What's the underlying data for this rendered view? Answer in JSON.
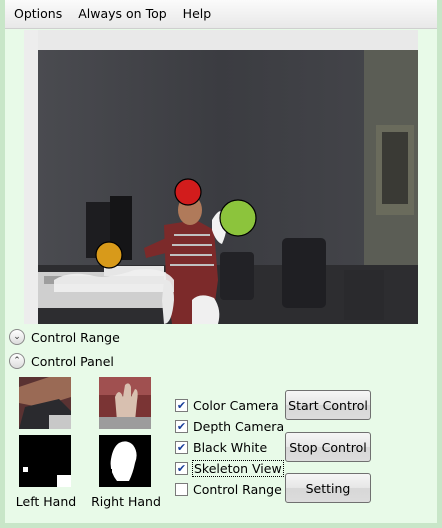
{
  "menu": {
    "items": [
      "Options",
      "Always on Top",
      "Help"
    ]
  },
  "expanders": {
    "control_range": "Control Range",
    "control_panel": "Control Panel"
  },
  "hands": {
    "left_label": "Left Hand",
    "right_label": "Right Hand"
  },
  "checkboxes": [
    {
      "label": "Color Camera",
      "checked": true
    },
    {
      "label": "Depth Camera",
      "checked": true
    },
    {
      "label": "Black White",
      "checked": true
    },
    {
      "label": "Skeleton View",
      "checked": true
    },
    {
      "label": "Control Range",
      "checked": false
    }
  ],
  "buttons": {
    "start": "Start Control",
    "stop": "Stop Control",
    "setting": "Setting"
  },
  "colors": {
    "head_marker": "#d21c1c",
    "right_hand_marker": "#8cc43c",
    "left_hand_marker": "#d89a1a",
    "window_bg": "#e8fae8"
  },
  "icons": {
    "expand": "chevron-down-icon",
    "collapse": "chevron-up-icon",
    "check": "checkmark-icon"
  }
}
